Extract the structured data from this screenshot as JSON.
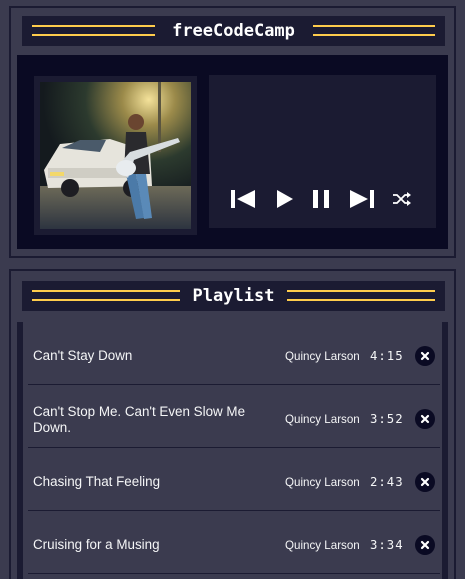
{
  "player": {
    "title": "freeCodeCamp"
  },
  "controls": [
    {
      "name": "previous-button",
      "icon": "skip-previous-icon"
    },
    {
      "name": "play-button",
      "icon": "play-icon"
    },
    {
      "name": "pause-button",
      "icon": "pause-icon"
    },
    {
      "name": "next-button",
      "icon": "skip-next-icon"
    },
    {
      "name": "shuffle-button",
      "icon": "shuffle-icon"
    }
  ],
  "playlist": {
    "title": "Playlist",
    "songs": [
      {
        "title": "Can't Stay Down",
        "artist": "Quincy Larson",
        "duration": "4:15"
      },
      {
        "title": "Can't Stop Me. Can't Even Slow Me Down.",
        "artist": "Quincy Larson",
        "duration": "3:52"
      },
      {
        "title": "Chasing That Feeling",
        "artist": "Quincy Larson",
        "duration": "2:43"
      },
      {
        "title": "Cruising for a Musing",
        "artist": "Quincy Larson",
        "duration": "3:34"
      }
    ]
  },
  "colors": {
    "accent": "#fecc4c",
    "dark": "#0a0a23",
    "panel": "#1b1b32",
    "bg": "#3b3b4f",
    "text": "#f5f6f7"
  }
}
